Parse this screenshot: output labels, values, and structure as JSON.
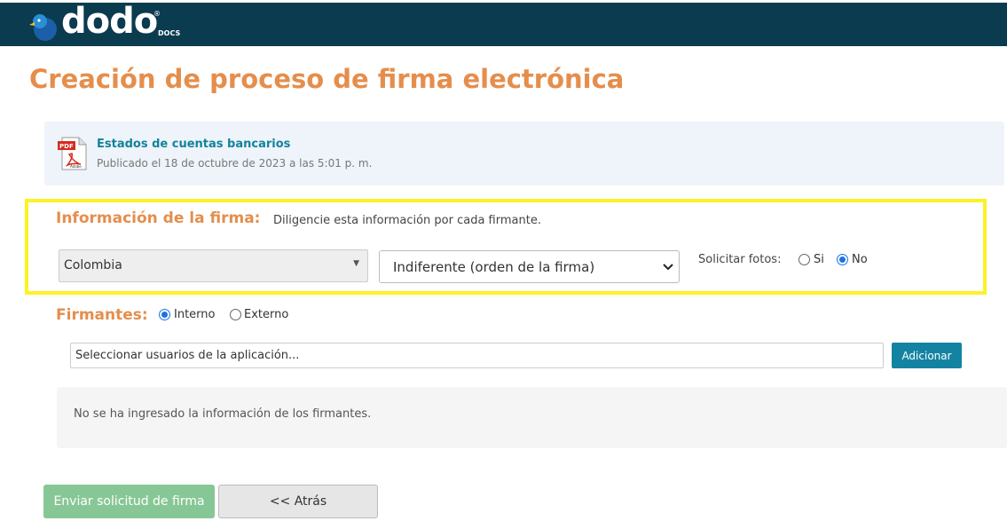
{
  "header": {
    "logo_text": "dodo",
    "logo_mark": "®",
    "logo_sub": "DOCS"
  },
  "page": {
    "title": "Creación de proceso de firma electrónica"
  },
  "document": {
    "icon": "pdf-icon",
    "name": "Estados de cuentas bancarios",
    "published": "Publicado el 18 de octubre de 2023 a las 5:01 p. m."
  },
  "firma": {
    "label": "Información de la firma:",
    "help": "Diligencie esta información por cada firmante.",
    "country_value": "Colombia",
    "order_value": "Indiferente (orden de la firma)",
    "fotos_label": "Solicitar fotos:",
    "fotos_si": "Si",
    "fotos_no": "No",
    "fotos_selected": "No"
  },
  "firmantes": {
    "label": "Firmantes:",
    "interno": "Interno",
    "externo": "Externo",
    "selected": "Interno",
    "search_value": "Seleccionar usuarios de la aplicación...",
    "add_label": "Adicionar",
    "empty_message": "No se ha ingresado la información de los firmantes."
  },
  "actions": {
    "send_label": "Enviar solicitud de firma",
    "back_label": "<< Atrás"
  },
  "colors": {
    "header_bg": "#0b3b4e",
    "title_orange": "#e58e4c",
    "link_teal": "#13839a",
    "highlight_yellow": "#fdf226",
    "add_button": "#1483a2",
    "send_button": "#87c795"
  }
}
